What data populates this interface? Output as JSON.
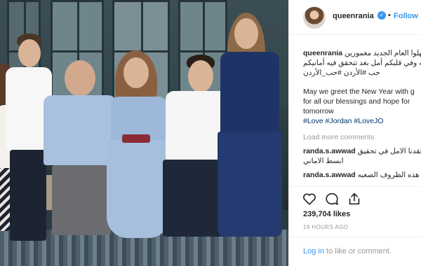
{
  "post": {
    "username": "queenrania",
    "follow_label": "Follow",
    "separator": "•",
    "verified_glyph": "✓"
  },
  "caption": {
    "username": "queenrania",
    "arabic_line_1": "تستهلوا العام الجديد مغمورين",
    "arabic_line_2": "بنعم الله وفي قلبكم أمل بغد تتحقق فيه أمانيكم",
    "arabic_line_3": "حب #الأردن #حب_الأردن",
    "english_line_1": "May we greet the New Year with g",
    "english_line_2": "for all our blessings and hope for",
    "english_line_3": "tomorrow",
    "hashtags": [
      "#Love",
      "#Jordan",
      "#LoveJO"
    ]
  },
  "comments": {
    "load_more": "Load more comments",
    "items": [
      {
        "user": "randa.s.awwad",
        "text_1": "اتي فقدنا الامل في تحقيق",
        "text_2": "ابسط الاماني"
      },
      {
        "user": "randa.s.awwad",
        "text_1": "ظل هذه الظروف الصعبه"
      }
    ]
  },
  "actions": {
    "like_icon": "heart-icon",
    "comment_icon": "comment-icon",
    "share_icon": "share-icon"
  },
  "likes": "239,704 likes",
  "timestamp": "19 HOURS AGO",
  "login": {
    "link": "Log in",
    "rest": " to like or comment."
  }
}
